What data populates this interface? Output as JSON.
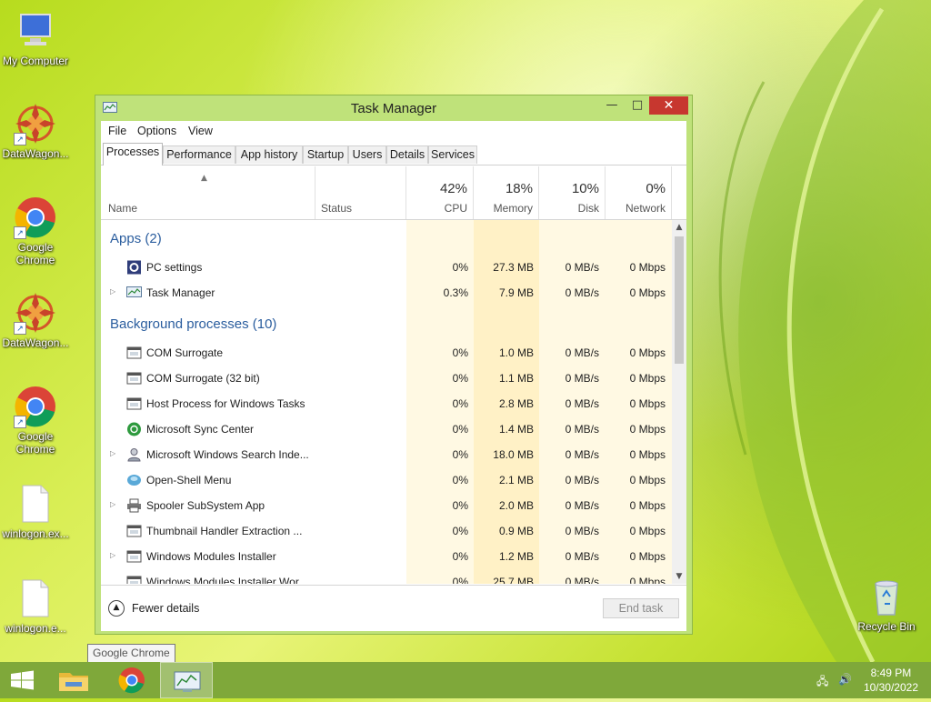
{
  "desktop": {
    "icons": [
      {
        "label": "My Computer",
        "icon": "computer-icon"
      },
      {
        "label": "DataWagon...",
        "icon": "datawagon-icon"
      },
      {
        "label": "Google Chrome",
        "icon": "chrome-icon"
      },
      {
        "label": "DataWagon...",
        "icon": "datawagon-icon"
      },
      {
        "label": "Google Chrome",
        "icon": "chrome-icon"
      },
      {
        "label": "winlogon.ex...",
        "icon": "file-icon"
      },
      {
        "label": "winlogon.e...",
        "icon": "file-icon"
      },
      {
        "label": "Recycle Bin",
        "icon": "recycle-bin-icon"
      }
    ]
  },
  "window": {
    "title": "Task Manager",
    "close": "✕",
    "menu": [
      "File",
      "Options",
      "View"
    ],
    "tabs": [
      "Processes",
      "Performance",
      "App history",
      "Startup",
      "Users",
      "Details",
      "Services"
    ],
    "active_tab": "Processes",
    "columns": {
      "name": "Name",
      "status": "Status",
      "cpu": {
        "pct": "42%",
        "label": "CPU"
      },
      "memory": {
        "pct": "18%",
        "label": "Memory"
      },
      "disk": {
        "pct": "10%",
        "label": "Disk"
      },
      "network": {
        "pct": "0%",
        "label": "Network"
      }
    },
    "groups": {
      "apps": "Apps (2)",
      "background": "Background processes (10)"
    },
    "apps": [
      {
        "name": "PC settings",
        "icon": "gear-icon",
        "expandable": false,
        "cpu": "0%",
        "memory": "27.3 MB",
        "disk": "0 MB/s",
        "network": "0 Mbps"
      },
      {
        "name": "Task Manager",
        "icon": "task-manager-icon",
        "expandable": true,
        "cpu": "0.3%",
        "memory": "7.9 MB",
        "disk": "0 MB/s",
        "network": "0 Mbps"
      }
    ],
    "background": [
      {
        "name": "COM Surrogate",
        "icon": "window-process-icon",
        "expandable": false,
        "cpu": "0%",
        "memory": "1.0 MB",
        "disk": "0 MB/s",
        "network": "0 Mbps"
      },
      {
        "name": "COM Surrogate (32 bit)",
        "icon": "window-process-icon",
        "expandable": false,
        "cpu": "0%",
        "memory": "1.1 MB",
        "disk": "0 MB/s",
        "network": "0 Mbps"
      },
      {
        "name": "Host Process for Windows Tasks",
        "icon": "window-process-icon",
        "expandable": false,
        "cpu": "0%",
        "memory": "2.8 MB",
        "disk": "0 MB/s",
        "network": "0 Mbps"
      },
      {
        "name": "Microsoft Sync Center",
        "icon": "sync-icon",
        "expandable": false,
        "cpu": "0%",
        "memory": "1.4 MB",
        "disk": "0 MB/s",
        "network": "0 Mbps"
      },
      {
        "name": "Microsoft Windows Search Inde...",
        "icon": "search-user-icon",
        "expandable": true,
        "cpu": "0%",
        "memory": "18.0 MB",
        "disk": "0 MB/s",
        "network": "0 Mbps"
      },
      {
        "name": "Open-Shell Menu",
        "icon": "shell-icon",
        "expandable": false,
        "cpu": "0%",
        "memory": "2.1 MB",
        "disk": "0 MB/s",
        "network": "0 Mbps"
      },
      {
        "name": "Spooler SubSystem App",
        "icon": "printer-icon",
        "expandable": true,
        "cpu": "0%",
        "memory": "2.0 MB",
        "disk": "0 MB/s",
        "network": "0 Mbps"
      },
      {
        "name": "Thumbnail Handler Extraction ...",
        "icon": "window-process-icon",
        "expandable": false,
        "cpu": "0%",
        "memory": "0.9 MB",
        "disk": "0 MB/s",
        "network": "0 Mbps"
      },
      {
        "name": "Windows Modules Installer",
        "icon": "window-process-icon",
        "expandable": true,
        "cpu": "0%",
        "memory": "1.2 MB",
        "disk": "0 MB/s",
        "network": "0 Mbps"
      },
      {
        "name": "Windows Modules Installer Wor...",
        "icon": "window-process-icon",
        "expandable": false,
        "cpu": "0%",
        "memory": "25.7 MB",
        "disk": "0 MB/s",
        "network": "0 Mbps"
      }
    ],
    "footer": {
      "fewer_details": "Fewer details",
      "end_task": "End task"
    }
  },
  "tooltip": "Google Chrome",
  "taskbar": {
    "clock_time": "8:49 PM",
    "clock_date": "10/30/2022"
  },
  "colors": {
    "heat_light": "#fff9e3",
    "heat_mid": "#fff1c6",
    "group_text": "#2a5d9e",
    "close_button": "#c7372f"
  }
}
